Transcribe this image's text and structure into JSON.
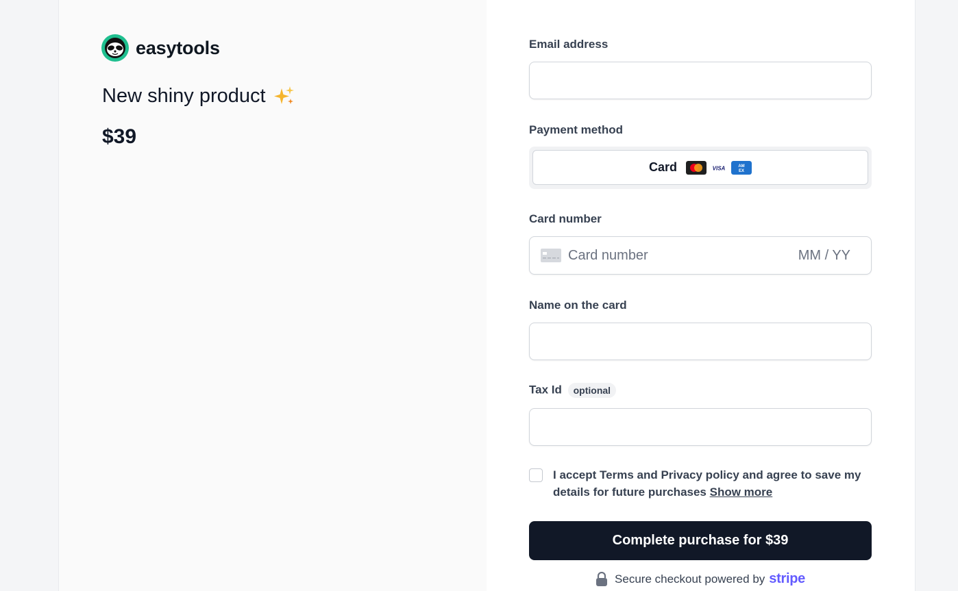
{
  "brand": {
    "name": "easytools"
  },
  "product": {
    "title": "New shiny product",
    "price": "$39"
  },
  "form": {
    "email_label": "Email address",
    "email_value": "",
    "payment_label": "Payment method",
    "payment_method": "Card",
    "card_label": "Card number",
    "card_placeholder": "Card number",
    "expiry_placeholder": "MM / YY",
    "name_label": "Name on the card",
    "name_value": "",
    "tax_label": "Tax Id",
    "tax_badge": "optional",
    "tax_value": "",
    "consent_text": "I accept Terms and Privacy policy and agree to save my details for future purchases",
    "show_more": "Show more",
    "submit_label": "Complete purchase for $39"
  },
  "footer": {
    "secure_text": "Secure checkout powered by",
    "stripe": "stripe"
  },
  "icons": {
    "logo": "sloth-logo-icon",
    "sparkle": "sparkles-icon",
    "mastercard": "mastercard-icon",
    "visa": "visa-icon",
    "amex": "amex-icon",
    "card": "credit-card-icon",
    "lock": "lock-icon"
  },
  "colors": {
    "accent": "#111827",
    "stripe": "#635bff",
    "logo_green": "#1fbf8f"
  }
}
